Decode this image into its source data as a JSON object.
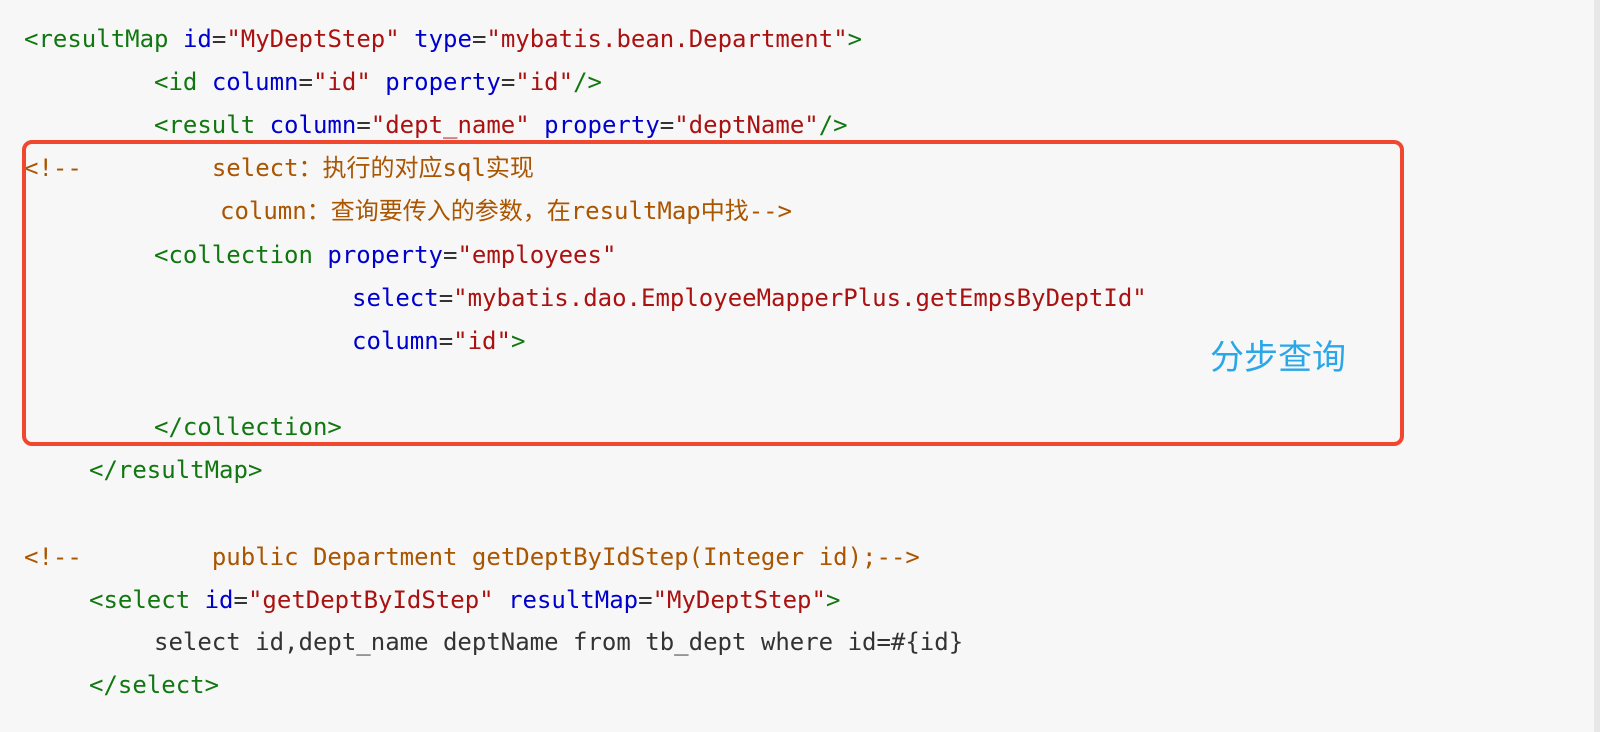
{
  "lines": {
    "l1": {
      "open": "<resultMap",
      "a1": "id",
      "v1": "\"MyDeptStep\"",
      "a2": "type",
      "v2": "\"mybatis.bean.Department\"",
      "close": ">"
    },
    "l2": {
      "open": "<id",
      "a1": "column",
      "v1": "\"id\"",
      "a2": "property",
      "v2": "\"id\"",
      "close": "/>"
    },
    "l3": {
      "open": "<result",
      "a1": "column",
      "v1": "\"dept_name\"",
      "a2": "property",
      "v2": "\"deptName\"",
      "close": "/>"
    },
    "l4": {
      "comment": "<!--         select：执行的对应sql实现"
    },
    "l5": {
      "comment": "column：查询要传入的参数，在resultMap中找-->"
    },
    "l6": {
      "open": "<collection",
      "a1": "property",
      "v1": "\"employees\""
    },
    "l7": {
      "a1": "select",
      "v1": "\"mybatis.dao.EmployeeMapperPlus.getEmpsByDeptId\""
    },
    "l8": {
      "a1": "column",
      "v1": "\"id\"",
      "close": ">"
    },
    "l10": {
      "tag": "</collection>"
    },
    "l11": {
      "tag": "</resultMap>"
    },
    "l13": {
      "comment": "<!--         public Department getDeptByIdStep(Integer id);-->"
    },
    "l14": {
      "open": "<select",
      "a1": "id",
      "v1": "\"getDeptByIdStep\"",
      "a2": "resultMap",
      "v2": "\"MyDeptStep\"",
      "close": ">"
    },
    "l15": {
      "text": "select id,dept_name deptName from tb_dept where id=#{id}"
    },
    "l16": {
      "tag": "</select>"
    }
  },
  "symbols": {
    "eq": "="
  },
  "annotation": {
    "label": "分步查询"
  },
  "colors": {
    "tag": "#117711",
    "attribute": "#0000cc",
    "value": "#aa1111",
    "comment": "#aa5500",
    "highlight_border": "#f0472e",
    "annotation": "#2aa7e8"
  }
}
